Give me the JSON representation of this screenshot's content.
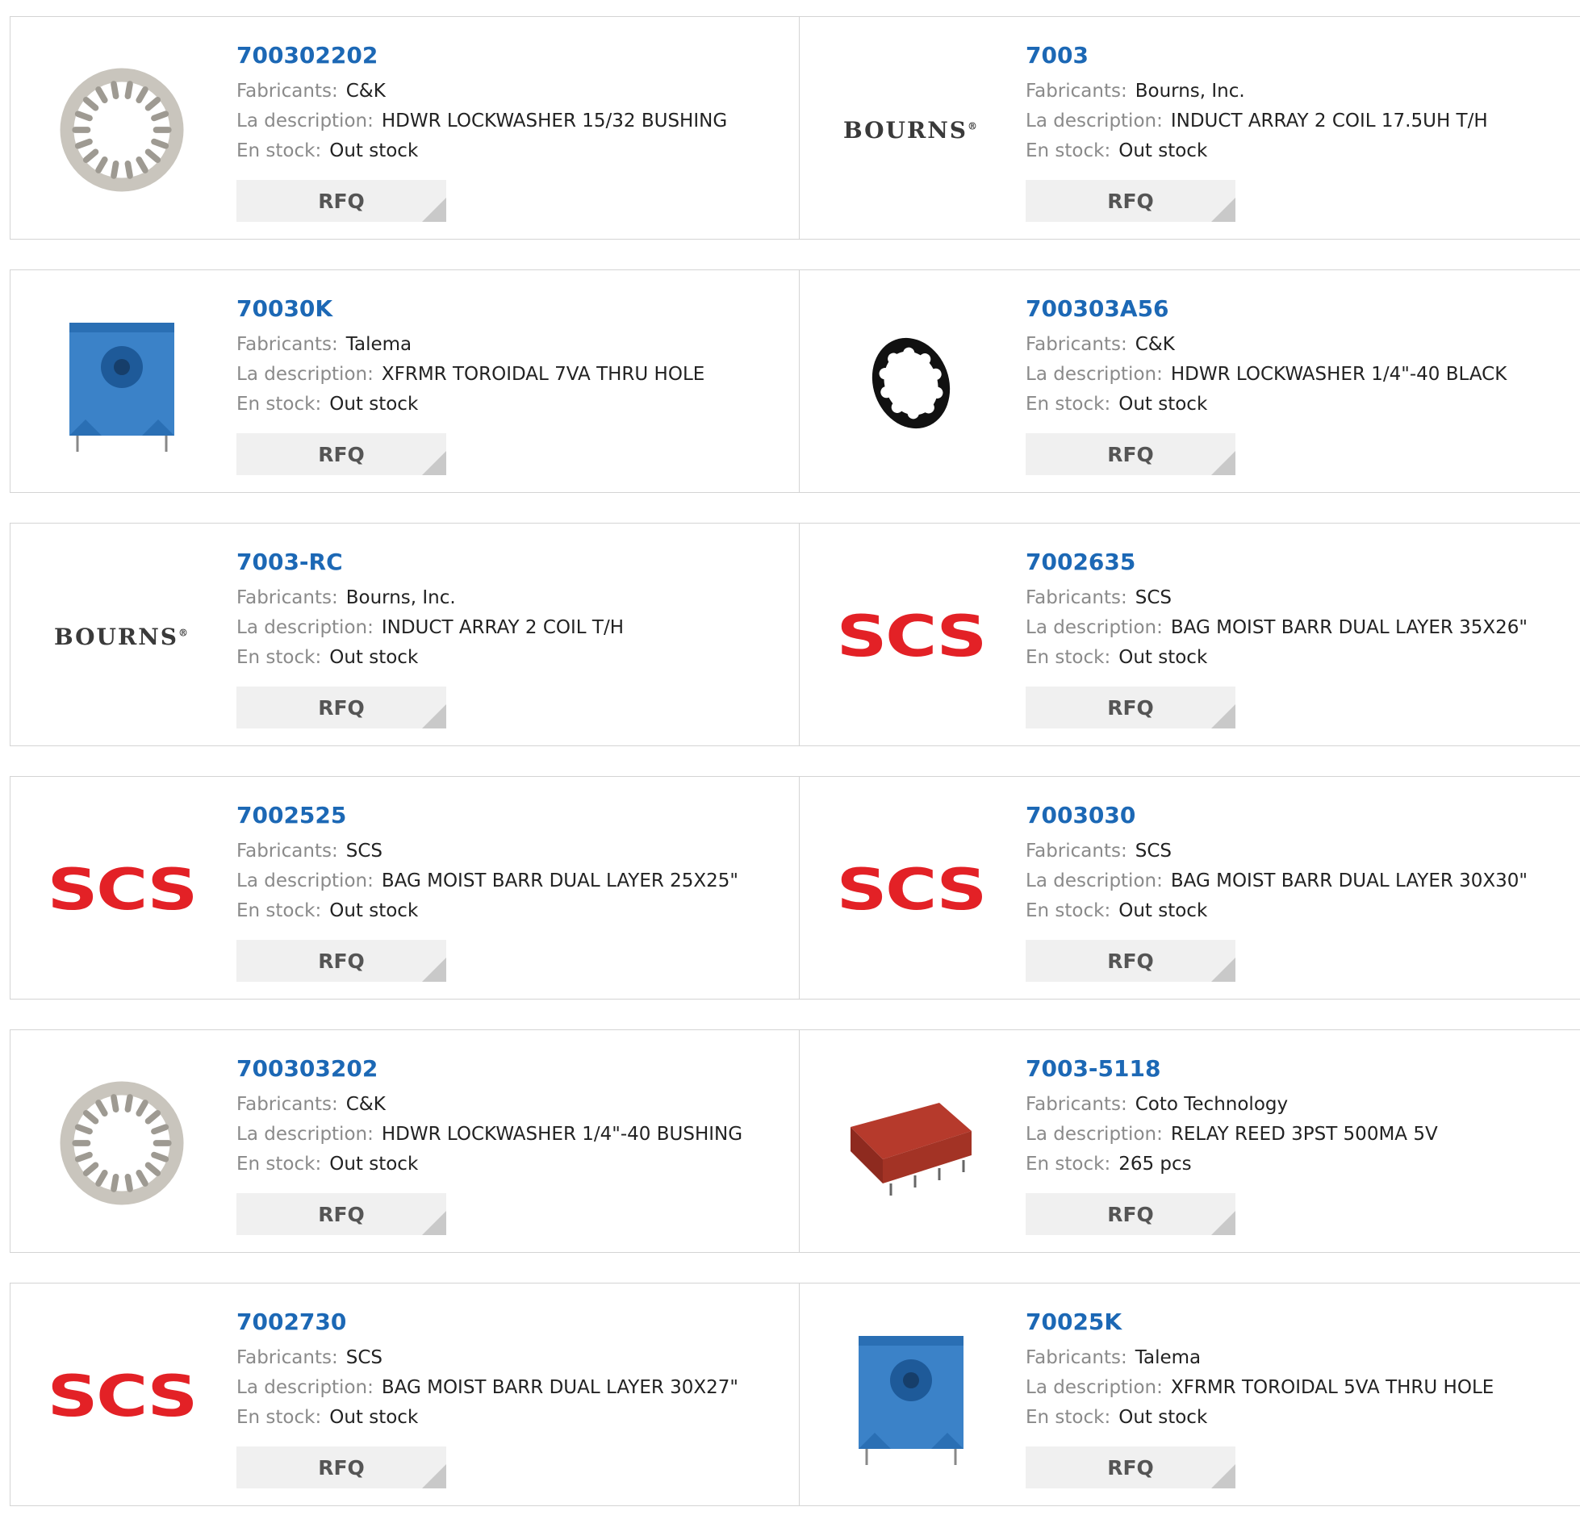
{
  "labels": {
    "manufacturer": "Fabricants:",
    "description": "La description:",
    "stock": "En stock:",
    "rfq": "RFQ"
  },
  "brand_colors": {
    "part_link": "#1c68b5",
    "scs_red": "#e32126"
  },
  "products": [
    {
      "part": "700302202",
      "manufacturer": "C&K",
      "description": "HDWR LOCKWASHER 15/32 BUSHING",
      "stock": "Out stock",
      "image": "lockwasher-silver-icon"
    },
    {
      "part": "7003",
      "manufacturer": "Bourns, Inc.",
      "description": "INDUCT ARRAY 2 COIL 17.5UH T/H",
      "stock": "Out stock",
      "image": "bourns-logo",
      "logo_text": "BOURNS"
    },
    {
      "part": "70030K",
      "manufacturer": "Talema",
      "description": "XFRMR TOROIDAL 7VA THRU HOLE",
      "stock": "Out stock",
      "image": "transformer-blue-icon"
    },
    {
      "part": "700303A56",
      "manufacturer": "C&K",
      "description": "HDWR LOCKWASHER 1/4\"-40 BLACK",
      "stock": "Out stock",
      "image": "lockwasher-black-icon"
    },
    {
      "part": "7003-RC",
      "manufacturer": "Bourns, Inc.",
      "description": "INDUCT ARRAY 2 COIL T/H",
      "stock": "Out stock",
      "image": "bourns-logo",
      "logo_text": "BOURNS"
    },
    {
      "part": "7002635",
      "manufacturer": "SCS",
      "description": "BAG MOIST BARR DUAL LAYER 35X26\"",
      "stock": "Out stock",
      "image": "scs-logo",
      "logo_text": "SCS"
    },
    {
      "part": "7002525",
      "manufacturer": "SCS",
      "description": "BAG MOIST BARR DUAL LAYER 25X25\"",
      "stock": "Out stock",
      "image": "scs-logo",
      "logo_text": "SCS"
    },
    {
      "part": "7003030",
      "manufacturer": "SCS",
      "description": "BAG MOIST BARR DUAL LAYER 30X30\"",
      "stock": "Out stock",
      "image": "scs-logo",
      "logo_text": "SCS"
    },
    {
      "part": "700303202",
      "manufacturer": "C&K",
      "description": "HDWR LOCKWASHER 1/4\"-40 BUSHING",
      "stock": "Out stock",
      "image": "lockwasher-silver-icon"
    },
    {
      "part": "7003-5118",
      "manufacturer": "Coto Technology",
      "description": "RELAY REED 3PST 500MA 5V",
      "stock": "265 pcs",
      "image": "relay-red-icon"
    },
    {
      "part": "7002730",
      "manufacturer": "SCS",
      "description": "BAG MOIST BARR DUAL LAYER 30X27\"",
      "stock": "Out stock",
      "image": "scs-logo",
      "logo_text": "SCS"
    },
    {
      "part": "70025K",
      "manufacturer": "Talema",
      "description": "XFRMR TOROIDAL 5VA THRU HOLE",
      "stock": "Out stock",
      "image": "transformer-blue-icon"
    }
  ]
}
